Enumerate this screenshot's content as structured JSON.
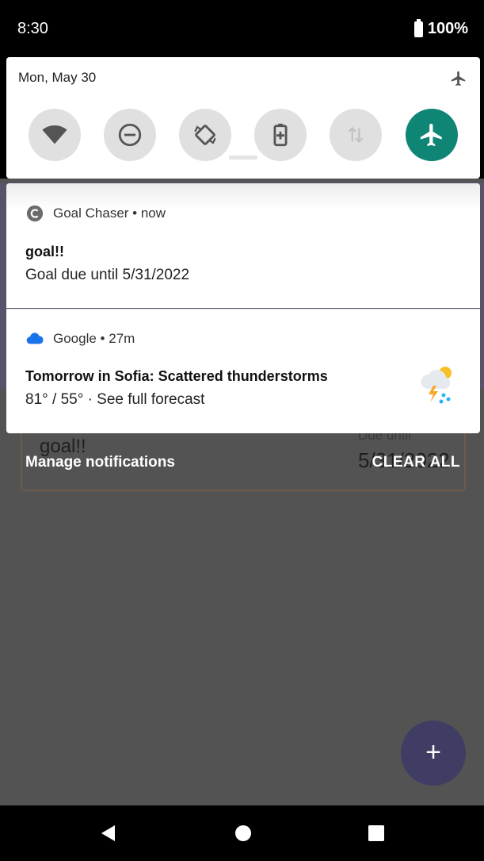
{
  "status_bar": {
    "time": "8:30",
    "battery": "100%"
  },
  "quick_settings": {
    "date": "Mon, May 30",
    "tiles": [
      {
        "icon": "wifi-icon",
        "active": false
      },
      {
        "icon": "do-not-disturb-icon",
        "active": false
      },
      {
        "icon": "auto-rotate-icon",
        "active": false
      },
      {
        "icon": "battery-saver-icon",
        "active": false
      },
      {
        "icon": "mobile-data-icon",
        "active": false
      },
      {
        "icon": "airplane-mode-icon",
        "active": true
      }
    ],
    "accent_color": "#0f8576"
  },
  "notifications": [
    {
      "app": "Goal Chaser",
      "time": "now",
      "title": "goal!!",
      "body": "Goal due until 5/31/2022"
    },
    {
      "app": "Google",
      "time": "27m",
      "title": "Tomorrow in Sofia: Scattered thunderstorms",
      "body": "81° / 55° · See full forecast"
    }
  ],
  "shade_actions": {
    "manage": "Manage notifications",
    "clear_all": "CLEAR ALL"
  },
  "background_app": {
    "goal_title": "goal!!",
    "due_label": "Due until",
    "due_value": "5/31/2022",
    "fab_label": "+"
  }
}
